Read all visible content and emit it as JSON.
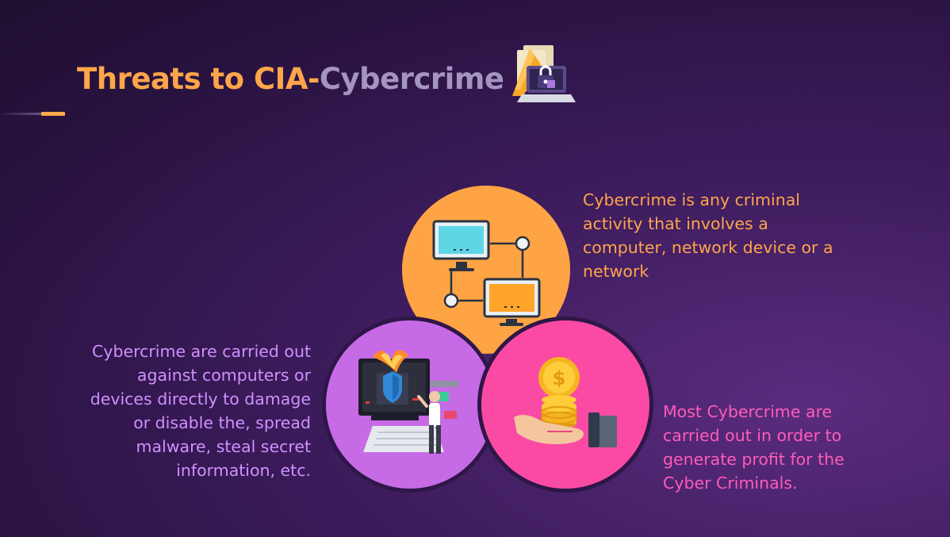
{
  "slide": {
    "title_part1": "Threats to CIA-",
    "title_part2": "Cybercrime",
    "title_icon": "hacker-laptop-lock-icon",
    "texts": {
      "top_right": "Cybercrime is any criminal activity that involves a computer, network device or a network",
      "left": "Cybercrime are carried out against computers or devices directly to damage or disable the, spread malware, steal secret information, etc.",
      "bottom_right": "Most Cybercrime are carried out in order to generate profit for the Cyber Criminals."
    },
    "circles": [
      {
        "name": "network-computers-circle",
        "color": "#ffa445",
        "icon": "network-computers-icon"
      },
      {
        "name": "hacker-attack-circle",
        "color": "#c66be5",
        "icon": "hacker-attack-icon"
      },
      {
        "name": "money-profit-circle",
        "color": "#fa4aa4",
        "icon": "coins-in-hand-icon"
      }
    ],
    "colors": {
      "accent_orange": "#ffa54a",
      "title_secondary": "#a394c0",
      "text_purple": "#cf90ff",
      "text_pink": "#ff5cb8"
    }
  }
}
